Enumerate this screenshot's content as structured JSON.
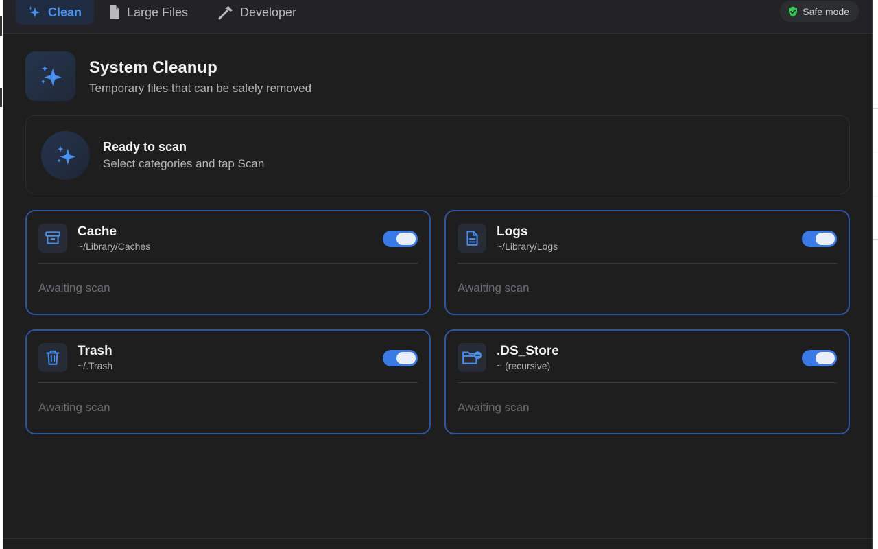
{
  "tabs": [
    {
      "label": "Clean",
      "icon": "sparkles-icon",
      "active": true
    },
    {
      "label": "Large Files",
      "icon": "document-icon",
      "active": false
    },
    {
      "label": "Developer",
      "icon": "hammer-icon",
      "active": false
    }
  ],
  "safe_mode": {
    "label": "Safe mode",
    "icon": "shield-check-icon",
    "color": "#34c759"
  },
  "header": {
    "title": "System Cleanup",
    "subtitle": "Temporary files that can be safely removed",
    "icon": "sparkles-icon"
  },
  "status": {
    "title": "Ready to scan",
    "subtitle": "Select categories and tap Scan",
    "icon": "sparkles-icon"
  },
  "categories": [
    {
      "name": "Cache",
      "path": "~/Library/Caches",
      "status": "Awaiting scan",
      "enabled": true,
      "icon": "archive-box-icon"
    },
    {
      "name": "Logs",
      "path": "~/Library/Logs",
      "status": "Awaiting scan",
      "enabled": true,
      "icon": "document-text-icon"
    },
    {
      "name": "Trash",
      "path": "~/.Trash",
      "status": "Awaiting scan",
      "enabled": true,
      "icon": "trash-icon"
    },
    {
      "name": ".DS_Store",
      "path": "~ (recursive)",
      "status": "Awaiting scan",
      "enabled": true,
      "icon": "folder-minus-icon"
    }
  ],
  "colors": {
    "accent": "#4a90f0",
    "toggle_on": "#3b7ae6",
    "card_border": "#2d56a0",
    "background": "#1e1e1f"
  }
}
